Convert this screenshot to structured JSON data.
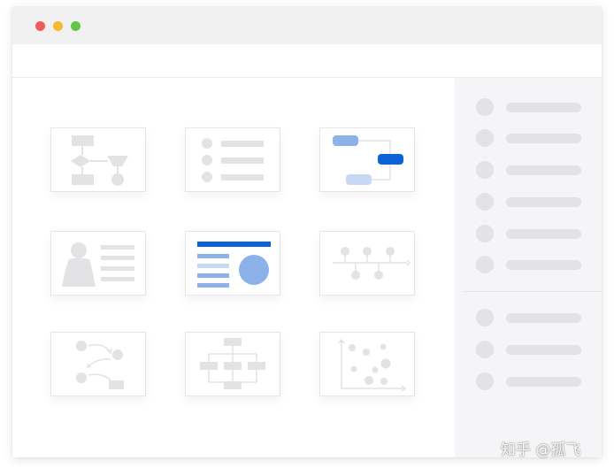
{
  "window": {
    "controls": {
      "close_color": "#ef5b5b",
      "minimize_color": "#f5b82e",
      "maximize_color": "#63c545"
    }
  },
  "theme": {
    "accent": "#0b63d7",
    "accent_light": "#8db2ea",
    "accent_pale": "#c6d8f4",
    "placeholder_gray": "#e3e3e5"
  },
  "templates": [
    {
      "id": "flowchart",
      "icon": "flowchart-icon"
    },
    {
      "id": "list",
      "icon": "list-icon"
    },
    {
      "id": "mind-map",
      "icon": "mind-map-icon",
      "selected_style": "accent"
    },
    {
      "id": "profile",
      "icon": "profile-card-icon"
    },
    {
      "id": "dashboard",
      "icon": "dashboard-icon",
      "selected_style": "accent"
    },
    {
      "id": "timeline",
      "icon": "timeline-icon"
    },
    {
      "id": "process",
      "icon": "process-flow-icon"
    },
    {
      "id": "org-chart",
      "icon": "org-chart-icon"
    },
    {
      "id": "scatter",
      "icon": "scatter-plot-icon"
    }
  ],
  "sidebar": {
    "group_1_count": 6,
    "group_2_count": 3
  },
  "watermark": {
    "text": "知乎 @孤飞"
  }
}
